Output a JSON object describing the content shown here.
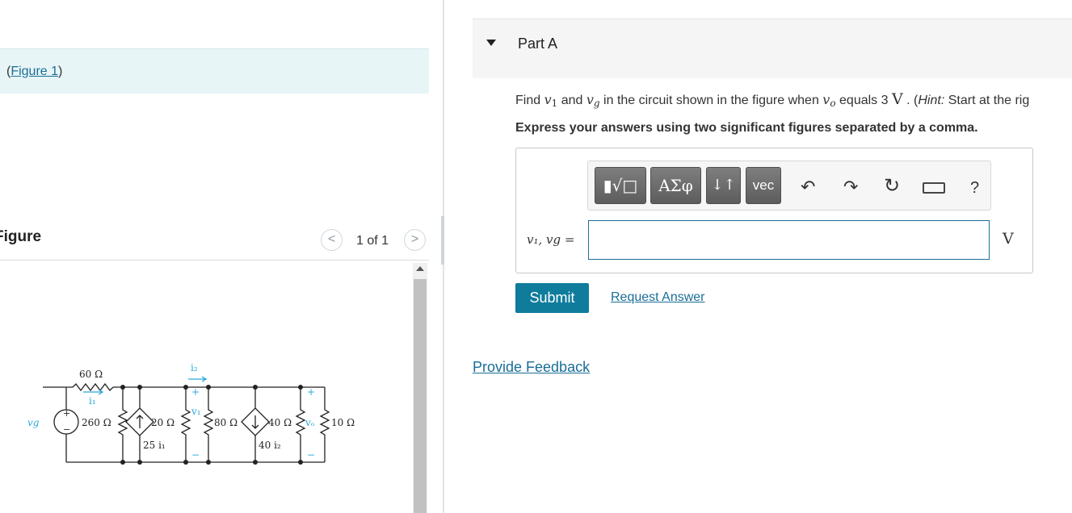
{
  "figure_panel": {
    "link_open": "(",
    "link_text": "Figure 1",
    "link_close": ")",
    "heading": "Figure",
    "pager": "1 of 1",
    "prev_icon": "chevron-left-icon",
    "next_icon": "chevron-right-icon"
  },
  "circuit": {
    "r_top": "60 Ω",
    "i1": "i₁",
    "i2": "i₂",
    "vg": "vg",
    "r260": "260 Ω",
    "r20": "20 Ω",
    "v1": "v₁",
    "r80": "80 Ω",
    "r40": "40 Ω",
    "vo": "vₒ",
    "r10": "10 Ω",
    "dep1": "25 i₁",
    "dep2": "40 i₂",
    "plus": "+",
    "minus": "−"
  },
  "part": {
    "title": "Part A",
    "question": {
      "find": "Find ",
      "v1": "v",
      "v1_sub": "1",
      "and": " and ",
      "vg": "v",
      "vg_sub": "g",
      "mid": " in the circuit shown in the figure when ",
      "vo": "v",
      "vo_sub": "o",
      "equals": " equals 3 ",
      "unit": "V",
      "dot": " . (",
      "hint": "Hint:",
      "rest": " Start at the rig"
    },
    "instruction": "Express your answers using two significant figures separated by a comma."
  },
  "toolbar": {
    "templates": "▮√□",
    "greek": "ΑΣφ",
    "arrows": "↓↑",
    "vec": "vec",
    "undo_icon": "undo-icon",
    "redo_icon": "redo-icon",
    "reset_icon": "reset-icon",
    "keyboard_icon": "keyboard-icon",
    "help": "?"
  },
  "answer": {
    "label": "v₁, vg =",
    "value": "",
    "unit": "V"
  },
  "actions": {
    "submit": "Submit",
    "request": "Request Answer",
    "feedback": "Provide Feedback"
  },
  "colors": {
    "accent": "#0f7c9c",
    "link": "#1a6e97",
    "figure_bar": "#e8f5f7",
    "circuit_blue": "#2aa7d8"
  }
}
